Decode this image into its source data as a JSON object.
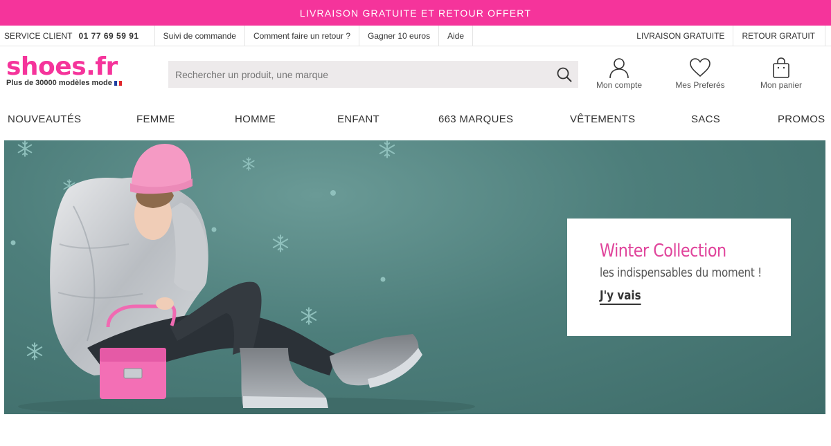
{
  "promo_bar": {
    "text": "LIVRAISON GRATUITE ET RETOUR OFFERT"
  },
  "utility_bar": {
    "service_label": "SERVICE CLIENT",
    "service_phone": "01 77 69 59 91",
    "links_left": [
      "Suivi de commande",
      "Comment faire un retour ?",
      "Gagner 10 euros",
      "Aide"
    ],
    "links_right": [
      "LIVRAISON GRATUITE",
      "RETOUR GRATUIT"
    ]
  },
  "header": {
    "logo_text": "shoes.fr",
    "tagline": "Plus de 30000 modèles mode",
    "search_placeholder": "Rechercher un produit, une marque",
    "search_value": "",
    "account_label": "Mon compte",
    "favorites_label": "Mes Preferés",
    "cart_label": "Mon panier"
  },
  "nav": {
    "items": [
      "NOUVEAUTÉS",
      "FEMME",
      "HOMME",
      "ENFANT",
      "663 MARQUES",
      "VÊTEMENTS",
      "SACS",
      "PROMOS"
    ]
  },
  "hero": {
    "title": "Winter Collection",
    "subtitle": "les indispensables du moment !",
    "cta": "J'y vais"
  },
  "colors": {
    "brand_pink": "#f5349b",
    "hero_teal": "#4d7e7b",
    "promo_title_pink": "#e0449b"
  },
  "icons": [
    "search-icon",
    "user-icon",
    "heart-icon",
    "bag-icon",
    "snowflake-icon",
    "flag-fr-icon"
  ]
}
